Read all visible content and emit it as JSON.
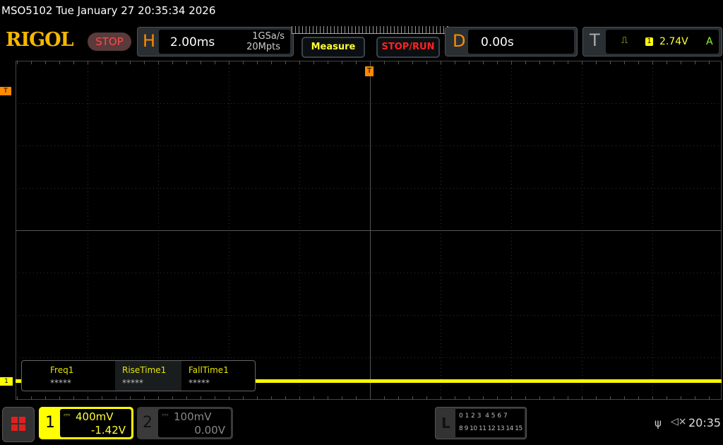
{
  "status_bar": {
    "title": "MSO5102  Tue January 27 20:35:34 2026"
  },
  "logo": "RIGOL",
  "run_state": "STOP",
  "horizontal": {
    "letter": "H",
    "timebase": "2.00ms",
    "sample_rate": "1GSa/s",
    "memory_depth": "20Mpts"
  },
  "buttons": {
    "measure": "Measure",
    "stop_run": "STOP/RUN"
  },
  "delay": {
    "letter": "D",
    "value": "0.00s"
  },
  "trigger": {
    "letter": "T",
    "slope_icon": "rising-edge-icon",
    "source": "1",
    "level": "2.74V",
    "mode": "A"
  },
  "markers": {
    "trigger_level": "T",
    "trigger_pos": "T",
    "ch1": "1"
  },
  "measurements": [
    {
      "label": "Freq1",
      "value": "*****"
    },
    {
      "label": "RiseTime1",
      "value": "*****"
    },
    {
      "label": "FallTime1",
      "value": "*****"
    }
  ],
  "channels": [
    {
      "num": "1",
      "scale": "400mV",
      "offset": "-1.42V",
      "coupling_icon": "dc-coupling-icon",
      "color": "#ffff00"
    },
    {
      "num": "2",
      "scale": "100mV",
      "offset": "0.00V",
      "coupling_icon": "dc-coupling-icon",
      "color": "#888888"
    }
  ],
  "logic": {
    "letter": "L",
    "row1": "0 1 2 3  4 5 6 7",
    "row2": "8 9 10 11 12 13 14 15"
  },
  "system": {
    "clock": "20:35",
    "usb_icon": "usb-icon",
    "mute_icon": "speaker-muted-icon"
  }
}
